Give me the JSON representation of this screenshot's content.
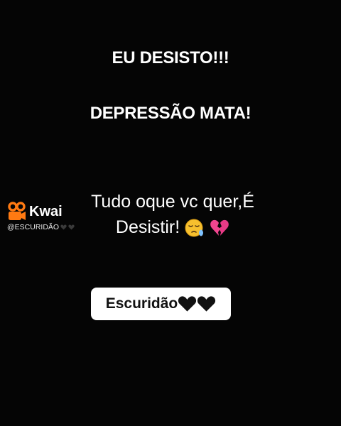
{
  "headline_1": "EU DESISTO!!!",
  "headline_2": "DEPRESSÃO MATA!",
  "message": {
    "line_1": "Tudo oque vc quer,É",
    "line_2": "Desistir!",
    "emojis": [
      "sleepy-face-icon",
      "broken-heart-icon"
    ]
  },
  "watermark": {
    "app_name": "Kwai",
    "handle": "@ESCURIDÃO",
    "logo_color": "#ff7a12"
  },
  "badge": {
    "label": "Escuridão",
    "icons": [
      "black-heart-icon",
      "black-heart-icon"
    ]
  },
  "colors": {
    "background": "#050505",
    "text": "#ffffff",
    "badge_background": "#ffffff",
    "broken_heart": "#f0458f"
  }
}
